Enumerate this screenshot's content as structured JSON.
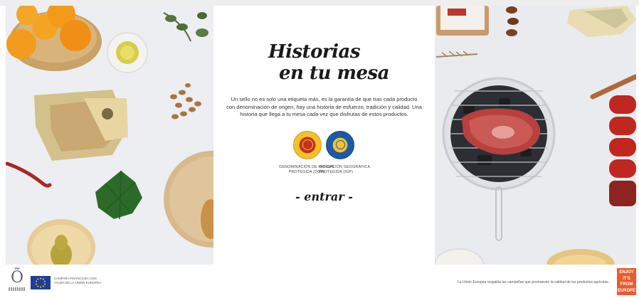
{
  "hero": {
    "title_line1": "Historias",
    "title_line2": "en tu mesa",
    "description": "Un sello no es solo una etiqueta más, es la garantía de que tras cada producto con denominación de origen, hay una historia de esfuerzo, tradición y calidad. Una historia que llega a tu mesa cada vez que disfrutas de estos productos.",
    "enter_label": "- entrar -"
  },
  "seals": [
    {
      "icon": "dop-seal-icon",
      "label": "DENOMINACIÓN DE ORIGEN PROTEGIDA (DOP)",
      "color": "#c4321f"
    },
    {
      "icon": "igp-seal-icon",
      "label": "INDICACIÓN GEOGRÁFICA PROTEGIDA (IGP)",
      "color": "#1d5aa6"
    }
  ],
  "footer": {
    "campaign_text": "CAMPAÑA FINANCIADA CON AYUDA DE LA UNIÓN EUROPEA",
    "notice": "La Unión Europea respalda las campañas que promueven la calidad de los productos agrícolas.",
    "enjoy_badge": "ENJOY IT'S FROM EUROPE",
    "logo_letter": "Õ"
  },
  "colors": {
    "background": "#eeeff3",
    "card": "#ffffff",
    "enjoy_badge": "#ea5b2c",
    "eu_blue": "#1f3e9b"
  }
}
